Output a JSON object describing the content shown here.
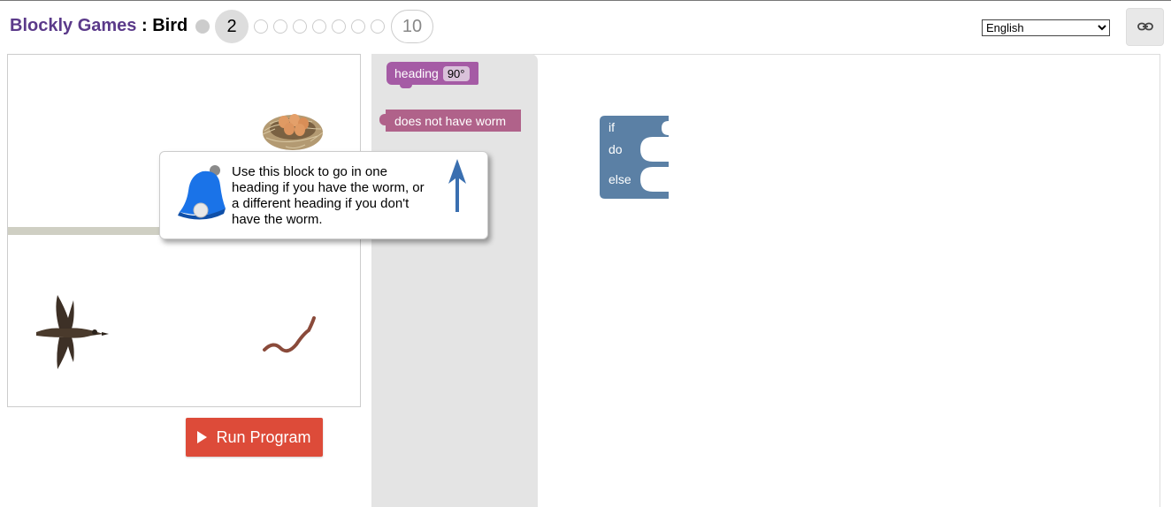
{
  "header": {
    "app_name": "Blockly Games",
    "separator": " : ",
    "game_name": "Bird",
    "current_level": "2",
    "last_level": "10",
    "language": "English"
  },
  "icons": {
    "link": "link-icon",
    "run": "play-icon",
    "bell": "bell-icon",
    "arrow": "arrow-up-icon"
  },
  "game": {
    "run_button_label": "Run Program"
  },
  "toolbox": {
    "heading_block_label": "heading",
    "heading_block_value": "90°",
    "condition_block_label": "does not have worm"
  },
  "workspace": {
    "if_label": "if",
    "do_label": "do",
    "else_label": "else"
  },
  "hint": {
    "text": "Use this block to go in one heading if you have the worm, or a different heading if you don't have the worm."
  },
  "colors": {
    "app_title": "#5b3a8a",
    "run_button": "#dd4b39",
    "heading_block": "#a55ba5",
    "condition_block": "#b0628a",
    "if_block": "#5b80a5",
    "bell": "#1a73e8"
  }
}
